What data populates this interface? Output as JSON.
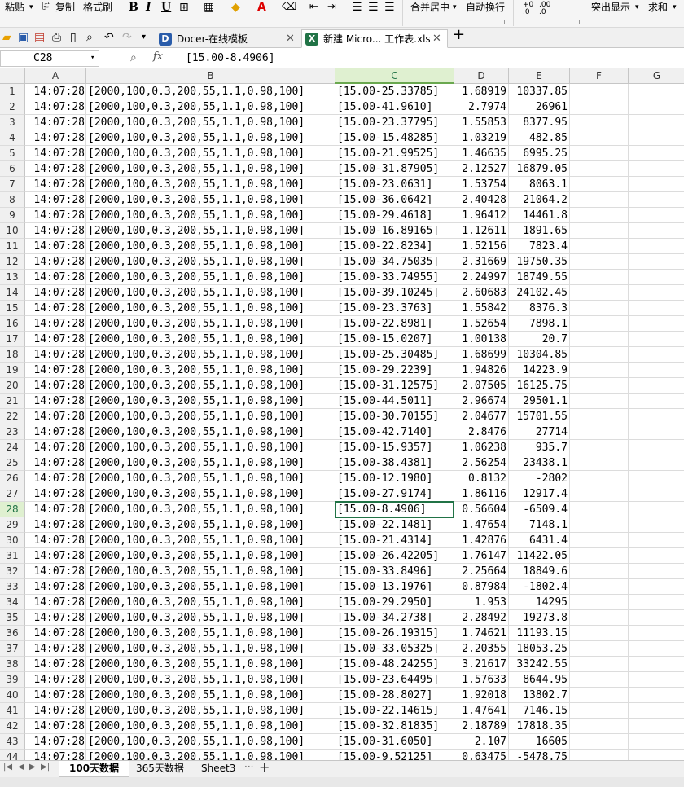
{
  "ribbon": {
    "paste": "粘贴",
    "copy": "复制",
    "format_painter": "格式刷",
    "bold": "B",
    "italic": "I",
    "underline": "U",
    "merge_center": "合并居中",
    "wrap_text": "自动换行",
    "inc_decimal": "+0 .0",
    "dec_decimal": ".00 .0",
    "highlight": "突出显示",
    "sum": "求和"
  },
  "doc_tabs": [
    {
      "title": "Docer-在线模板"
    },
    {
      "title": "新建 Micro... 工作表.xls"
    }
  ],
  "formula_bar": {
    "cell_ref": "C28",
    "fx": "fx",
    "value": "[15.00-8.4906]"
  },
  "columns": [
    "A",
    "B",
    "C",
    "D",
    "E",
    "F",
    "G"
  ],
  "selected": {
    "row": 28,
    "col": "C"
  },
  "rows": [
    {
      "n": "1",
      "a": "14:07:28",
      "b": "[2000,100,0.3,200,55,1.1,0.98,100]",
      "c": "[15.00-25.33785]",
      "d": "1.68919",
      "e": "10337.85"
    },
    {
      "n": "2",
      "a": "14:07:28",
      "b": "[2000,100,0.3,200,55,1.1,0.98,100]",
      "c": "[15.00-41.9610]",
      "d": "2.7974",
      "e": "26961"
    },
    {
      "n": "3",
      "a": "14:07:28",
      "b": "[2000,100,0.3,200,55,1.1,0.98,100]",
      "c": "[15.00-23.37795]",
      "d": "1.55853",
      "e": "8377.95"
    },
    {
      "n": "4",
      "a": "14:07:28",
      "b": "[2000,100,0.3,200,55,1.1,0.98,100]",
      "c": "[15.00-15.48285]",
      "d": "1.03219",
      "e": "482.85"
    },
    {
      "n": "5",
      "a": "14:07:28",
      "b": "[2000,100,0.3,200,55,1.1,0.98,100]",
      "c": "[15.00-21.99525]",
      "d": "1.46635",
      "e": "6995.25"
    },
    {
      "n": "6",
      "a": "14:07:28",
      "b": "[2000,100,0.3,200,55,1.1,0.98,100]",
      "c": "[15.00-31.87905]",
      "d": "2.12527",
      "e": "16879.05"
    },
    {
      "n": "7",
      "a": "14:07:28",
      "b": "[2000,100,0.3,200,55,1.1,0.98,100]",
      "c": "[15.00-23.0631]",
      "d": "1.53754",
      "e": "8063.1"
    },
    {
      "n": "8",
      "a": "14:07:28",
      "b": "[2000,100,0.3,200,55,1.1,0.98,100]",
      "c": "[15.00-36.0642]",
      "d": "2.40428",
      "e": "21064.2"
    },
    {
      "n": "9",
      "a": "14:07:28",
      "b": "[2000,100,0.3,200,55,1.1,0.98,100]",
      "c": "[15.00-29.4618]",
      "d": "1.96412",
      "e": "14461.8"
    },
    {
      "n": "10",
      "a": "14:07:28",
      "b": "[2000,100,0.3,200,55,1.1,0.98,100]",
      "c": "[15.00-16.89165]",
      "d": "1.12611",
      "e": "1891.65"
    },
    {
      "n": "11",
      "a": "14:07:28",
      "b": "[2000,100,0.3,200,55,1.1,0.98,100]",
      "c": "[15.00-22.8234]",
      "d": "1.52156",
      "e": "7823.4"
    },
    {
      "n": "12",
      "a": "14:07:28",
      "b": "[2000,100,0.3,200,55,1.1,0.98,100]",
      "c": "[15.00-34.75035]",
      "d": "2.31669",
      "e": "19750.35"
    },
    {
      "n": "13",
      "a": "14:07:28",
      "b": "[2000,100,0.3,200,55,1.1,0.98,100]",
      "c": "[15.00-33.74955]",
      "d": "2.24997",
      "e": "18749.55"
    },
    {
      "n": "14",
      "a": "14:07:28",
      "b": "[2000,100,0.3,200,55,1.1,0.98,100]",
      "c": "[15.00-39.10245]",
      "d": "2.60683",
      "e": "24102.45"
    },
    {
      "n": "15",
      "a": "14:07:28",
      "b": "[2000,100,0.3,200,55,1.1,0.98,100]",
      "c": "[15.00-23.3763]",
      "d": "1.55842",
      "e": "8376.3"
    },
    {
      "n": "16",
      "a": "14:07:28",
      "b": "[2000,100,0.3,200,55,1.1,0.98,100]",
      "c": "[15.00-22.8981]",
      "d": "1.52654",
      "e": "7898.1"
    },
    {
      "n": "17",
      "a": "14:07:28",
      "b": "[2000,100,0.3,200,55,1.1,0.98,100]",
      "c": "[15.00-15.0207]",
      "d": "1.00138",
      "e": "20.7"
    },
    {
      "n": "18",
      "a": "14:07:28",
      "b": "[2000,100,0.3,200,55,1.1,0.98,100]",
      "c": "[15.00-25.30485]",
      "d": "1.68699",
      "e": "10304.85"
    },
    {
      "n": "19",
      "a": "14:07:28",
      "b": "[2000,100,0.3,200,55,1.1,0.98,100]",
      "c": "[15.00-29.2239]",
      "d": "1.94826",
      "e": "14223.9"
    },
    {
      "n": "20",
      "a": "14:07:28",
      "b": "[2000,100,0.3,200,55,1.1,0.98,100]",
      "c": "[15.00-31.12575]",
      "d": "2.07505",
      "e": "16125.75"
    },
    {
      "n": "21",
      "a": "14:07:28",
      "b": "[2000,100,0.3,200,55,1.1,0.98,100]",
      "c": "[15.00-44.5011]",
      "d": "2.96674",
      "e": "29501.1"
    },
    {
      "n": "22",
      "a": "14:07:28",
      "b": "[2000,100,0.3,200,55,1.1,0.98,100]",
      "c": "[15.00-30.70155]",
      "d": "2.04677",
      "e": "15701.55"
    },
    {
      "n": "23",
      "a": "14:07:28",
      "b": "[2000,100,0.3,200,55,1.1,0.98,100]",
      "c": "[15.00-42.7140]",
      "d": "2.8476",
      "e": "27714"
    },
    {
      "n": "24",
      "a": "14:07:28",
      "b": "[2000,100,0.3,200,55,1.1,0.98,100]",
      "c": "[15.00-15.9357]",
      "d": "1.06238",
      "e": "935.7"
    },
    {
      "n": "25",
      "a": "14:07:28",
      "b": "[2000,100,0.3,200,55,1.1,0.98,100]",
      "c": "[15.00-38.4381]",
      "d": "2.56254",
      "e": "23438.1"
    },
    {
      "n": "26",
      "a": "14:07:28",
      "b": "[2000,100,0.3,200,55,1.1,0.98,100]",
      "c": "[15.00-12.1980]",
      "d": "0.8132",
      "e": "-2802"
    },
    {
      "n": "27",
      "a": "14:07:28",
      "b": "[2000,100,0.3,200,55,1.1,0.98,100]",
      "c": "[15.00-27.9174]",
      "d": "1.86116",
      "e": "12917.4"
    },
    {
      "n": "28",
      "a": "14:07:28",
      "b": "[2000,100,0.3,200,55,1.1,0.98,100]",
      "c": "[15.00-8.4906]",
      "d": "0.56604",
      "e": "-6509.4"
    },
    {
      "n": "29",
      "a": "14:07:28",
      "b": "[2000,100,0.3,200,55,1.1,0.98,100]",
      "c": "[15.00-22.1481]",
      "d": "1.47654",
      "e": "7148.1"
    },
    {
      "n": "30",
      "a": "14:07:28",
      "b": "[2000,100,0.3,200,55,1.1,0.98,100]",
      "c": "[15.00-21.4314]",
      "d": "1.42876",
      "e": "6431.4"
    },
    {
      "n": "31",
      "a": "14:07:28",
      "b": "[2000,100,0.3,200,55,1.1,0.98,100]",
      "c": "[15.00-26.42205]",
      "d": "1.76147",
      "e": "11422.05"
    },
    {
      "n": "32",
      "a": "14:07:28",
      "b": "[2000,100,0.3,200,55,1.1,0.98,100]",
      "c": "[15.00-33.8496]",
      "d": "2.25664",
      "e": "18849.6"
    },
    {
      "n": "33",
      "a": "14:07:28",
      "b": "[2000,100,0.3,200,55,1.1,0.98,100]",
      "c": "[15.00-13.1976]",
      "d": "0.87984",
      "e": "-1802.4"
    },
    {
      "n": "34",
      "a": "14:07:28",
      "b": "[2000,100,0.3,200,55,1.1,0.98,100]",
      "c": "[15.00-29.2950]",
      "d": "1.953",
      "e": "14295"
    },
    {
      "n": "35",
      "a": "14:07:28",
      "b": "[2000,100,0.3,200,55,1.1,0.98,100]",
      "c": "[15.00-34.2738]",
      "d": "2.28492",
      "e": "19273.8"
    },
    {
      "n": "36",
      "a": "14:07:28",
      "b": "[2000,100,0.3,200,55,1.1,0.98,100]",
      "c": "[15.00-26.19315]",
      "d": "1.74621",
      "e": "11193.15"
    },
    {
      "n": "37",
      "a": "14:07:28",
      "b": "[2000,100,0.3,200,55,1.1,0.98,100]",
      "c": "[15.00-33.05325]",
      "d": "2.20355",
      "e": "18053.25"
    },
    {
      "n": "38",
      "a": "14:07:28",
      "b": "[2000,100,0.3,200,55,1.1,0.98,100]",
      "c": "[15.00-48.24255]",
      "d": "3.21617",
      "e": "33242.55"
    },
    {
      "n": "39",
      "a": "14:07:28",
      "b": "[2000,100,0.3,200,55,1.1,0.98,100]",
      "c": "[15.00-23.64495]",
      "d": "1.57633",
      "e": "8644.95"
    },
    {
      "n": "40",
      "a": "14:07:28",
      "b": "[2000,100,0.3,200,55,1.1,0.98,100]",
      "c": "[15.00-28.8027]",
      "d": "1.92018",
      "e": "13802.7"
    },
    {
      "n": "41",
      "a": "14:07:28",
      "b": "[2000,100,0.3,200,55,1.1,0.98,100]",
      "c": "[15.00-22.14615]",
      "d": "1.47641",
      "e": "7146.15"
    },
    {
      "n": "42",
      "a": "14:07:28",
      "b": "[2000,100,0.3,200,55,1.1,0.98,100]",
      "c": "[15.00-32.81835]",
      "d": "2.18789",
      "e": "17818.35"
    },
    {
      "n": "43",
      "a": "14:07:28",
      "b": "[2000,100,0.3,200,55,1.1,0.98,100]",
      "c": "[15.00-31.6050]",
      "d": "2.107",
      "e": "16605"
    },
    {
      "n": "44",
      "a": "14:07:28",
      "b": "[2000,100,0.3,200,55,1.1,0.98,100]",
      "c": "[15.00-9.52125]",
      "d": "0.63475",
      "e": "-5478.75"
    }
  ],
  "sheet_tabs": [
    {
      "label": "100天数据",
      "active": true
    },
    {
      "label": "365天数据",
      "active": false
    },
    {
      "label": "Sheet3",
      "active": false
    }
  ],
  "colors": {
    "accent": "#217346",
    "header_bg": "#f0f0f0",
    "selected_header_bg": "#dff0d0"
  }
}
